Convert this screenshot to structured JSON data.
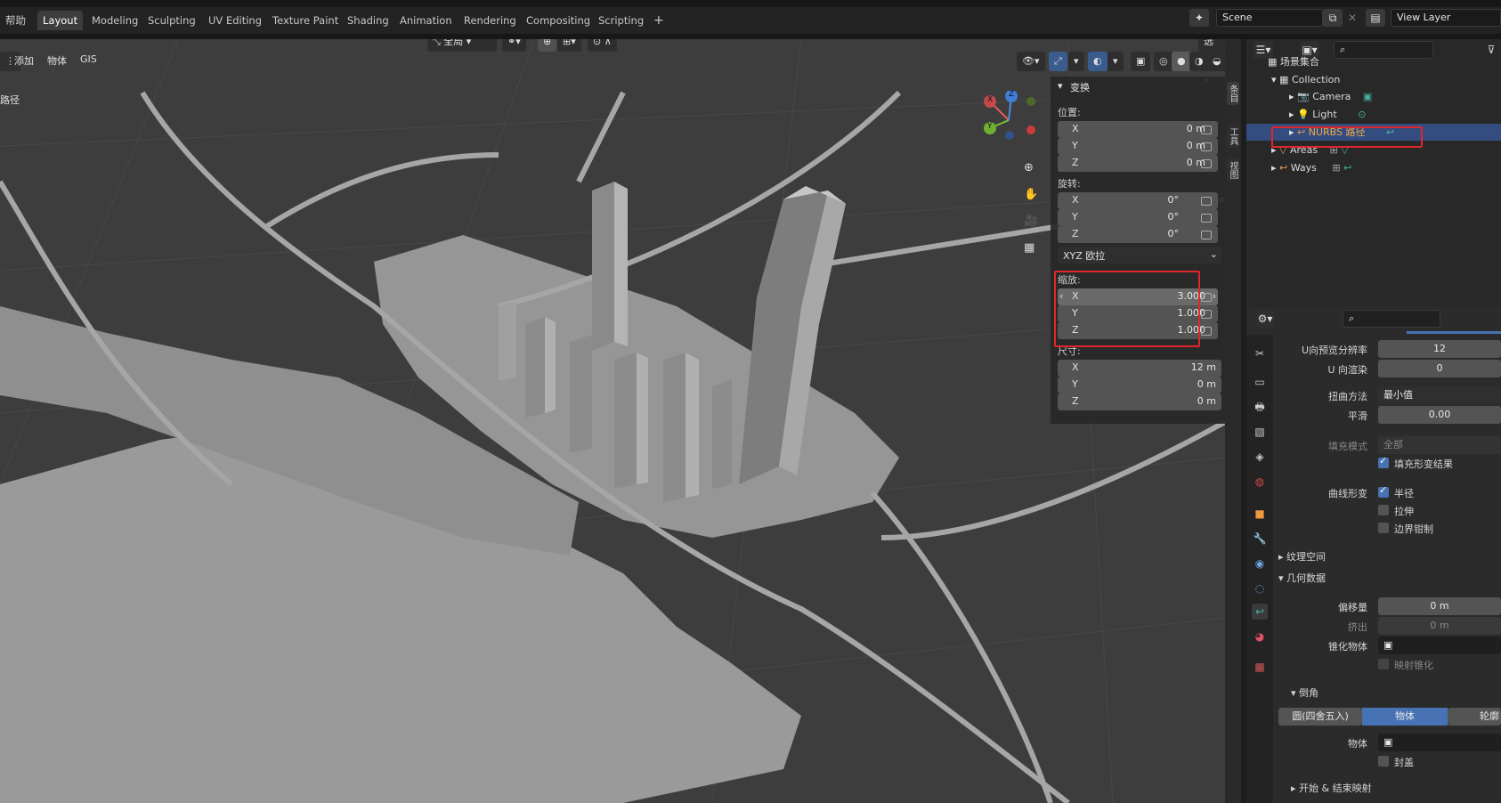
{
  "topbar": {
    "menu_fragment": "帮助",
    "tabs": [
      "Layout",
      "Modeling",
      "Sculpting",
      "UV Editing",
      "Texture Paint",
      "Shading",
      "Animation",
      "Rendering",
      "Compositing",
      "Scripting"
    ],
    "add_tab": "+",
    "scene": "Scene",
    "view_layer": "View Layer"
  },
  "viewport": {
    "menus": [
      "添加",
      "物体",
      "GIS"
    ],
    "left_label": "路径",
    "transform_orientation": "全局",
    "options": "选项",
    "gizmo": {
      "x": "X",
      "y": "Y",
      "z": "Z"
    }
  },
  "npanel": {
    "title": "变换",
    "location_label": "位置:",
    "location": [
      {
        "axis": "X",
        "value": "0 m"
      },
      {
        "axis": "Y",
        "value": "0 m"
      },
      {
        "axis": "Z",
        "value": "0 m"
      }
    ],
    "rotation_label": "旋转:",
    "rotation": [
      {
        "axis": "X",
        "value": "0°"
      },
      {
        "axis": "Y",
        "value": "0°"
      },
      {
        "axis": "Z",
        "value": "0°"
      }
    ],
    "rotation_mode": "XYZ 欧拉",
    "scale_label": "缩放:",
    "scale": [
      {
        "axis": "X",
        "value": "3.000"
      },
      {
        "axis": "Y",
        "value": "1.000"
      },
      {
        "axis": "Z",
        "value": "1.000"
      }
    ],
    "dimensions_label": "尺寸:",
    "dimensions": [
      {
        "axis": "X",
        "value": "12 m"
      },
      {
        "axis": "Y",
        "value": "0 m"
      },
      {
        "axis": "Z",
        "value": "0 m"
      }
    ]
  },
  "sidetabs": [
    "条目",
    "工具",
    "视图"
  ],
  "outliner": {
    "root": "场景集合",
    "collection": "Collection",
    "items": [
      "Camera",
      "Light",
      "NURBS 路径",
      "Areas",
      "Ways"
    ]
  },
  "props": {
    "u_preview_label": "U向预览分辨率",
    "u_preview": "12",
    "u_render_label": "U 向渲染",
    "u_render": "0",
    "twist_label": "扭曲方法",
    "twist": "最小值",
    "smooth_label": "平滑",
    "smooth": "0.00",
    "fill_mode_label": "填充模式",
    "fill_mode": "全部",
    "fill_deform": "填充形变结果",
    "curve_deform_label": "曲线形变",
    "radius": "半径",
    "stretch": "拉伸",
    "bounds_clamp": "边界钳制",
    "texture_space": "纹理空间",
    "geometry": "几何数据",
    "offset_label": "偏移量",
    "offset": "0 m",
    "extrude_label": "挤出",
    "extrude": "0 m",
    "taper_label": "锥化物体",
    "map_taper": "映射锥化",
    "bevel": "倒角",
    "bevel_modes": [
      "圆(四舍五入)",
      "物体",
      "轮廓"
    ],
    "object_label": "物体",
    "fill_caps": "封盖",
    "start_end": "开始 & 结束映射"
  },
  "colors": {
    "accent": "#4772b3",
    "selected": "#334d80",
    "highlight": "#e0262b"
  }
}
